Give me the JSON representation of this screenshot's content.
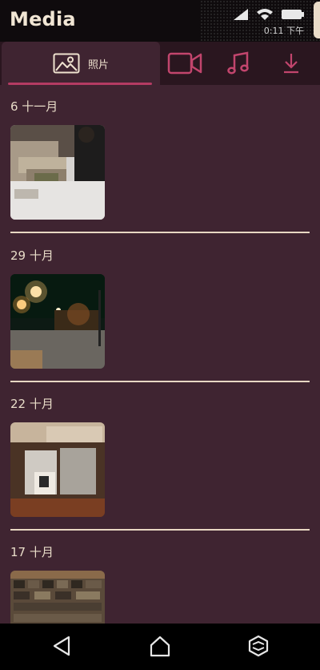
{
  "app": {
    "title": "Media"
  },
  "status_bar": {
    "time": "0:11 下午"
  },
  "tabs": [
    {
      "label": "照片",
      "icon": "image-icon",
      "active": true
    },
    {
      "label": "",
      "icon": "video-camera-icon",
      "active": false
    },
    {
      "label": "",
      "icon": "music-note-icon",
      "active": false
    },
    {
      "label": "",
      "icon": "download-icon",
      "active": false
    }
  ],
  "sections": [
    {
      "date": "6 十一月"
    },
    {
      "date": "29 十月"
    },
    {
      "date": "22 十月"
    },
    {
      "date": "17 十月"
    }
  ],
  "colors": {
    "background": "#3f2431",
    "tab_bar": "#2a161f",
    "accent": "#b43b63",
    "text": "#e8dcc8",
    "divider": "#e8d7c3"
  },
  "nav": {
    "back": "back-icon",
    "home": "home-icon",
    "recents": "recents-icon"
  }
}
